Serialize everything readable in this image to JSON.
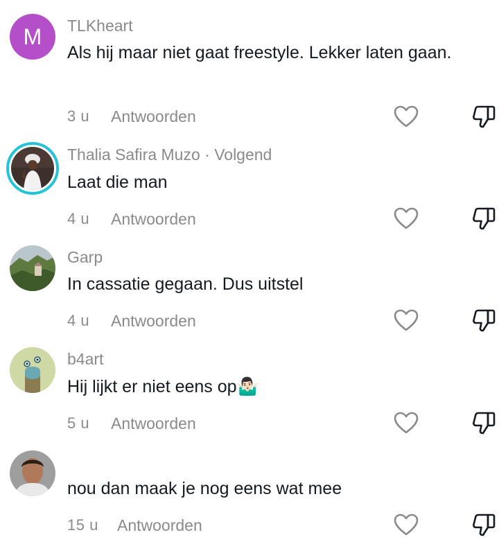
{
  "comments": [
    {
      "author": "TLKheart",
      "avatar_letter": "M",
      "text": "Als hij maar niet gaat freestyle. Lekker laten gaan.",
      "time": "3 u",
      "reply": "Antwoorden"
    },
    {
      "author": "Thalia Safira Muzo",
      "following": "Volgend",
      "text": "Laat die man",
      "time": "4 u",
      "reply": "Antwoorden"
    },
    {
      "author": "Garp",
      "text": "In cassatie gegaan. Dus uitstel",
      "time": "4 u",
      "reply": "Antwoorden"
    },
    {
      "author": "b4art",
      "text": "Hij lijkt er niet eens op",
      "emoji": "🤷🏻‍♂️",
      "time": "5 u",
      "reply": "Antwoorden"
    },
    {
      "author": "",
      "text": "nou dan maak je nog eens wat mee",
      "time": "15 u",
      "reply": "Antwoorden"
    }
  ],
  "colors": {
    "avatar_m": "#b44fc9",
    "story_ring": "#25c3d8",
    "text": "#161823",
    "muted": "#8a8a8a"
  }
}
